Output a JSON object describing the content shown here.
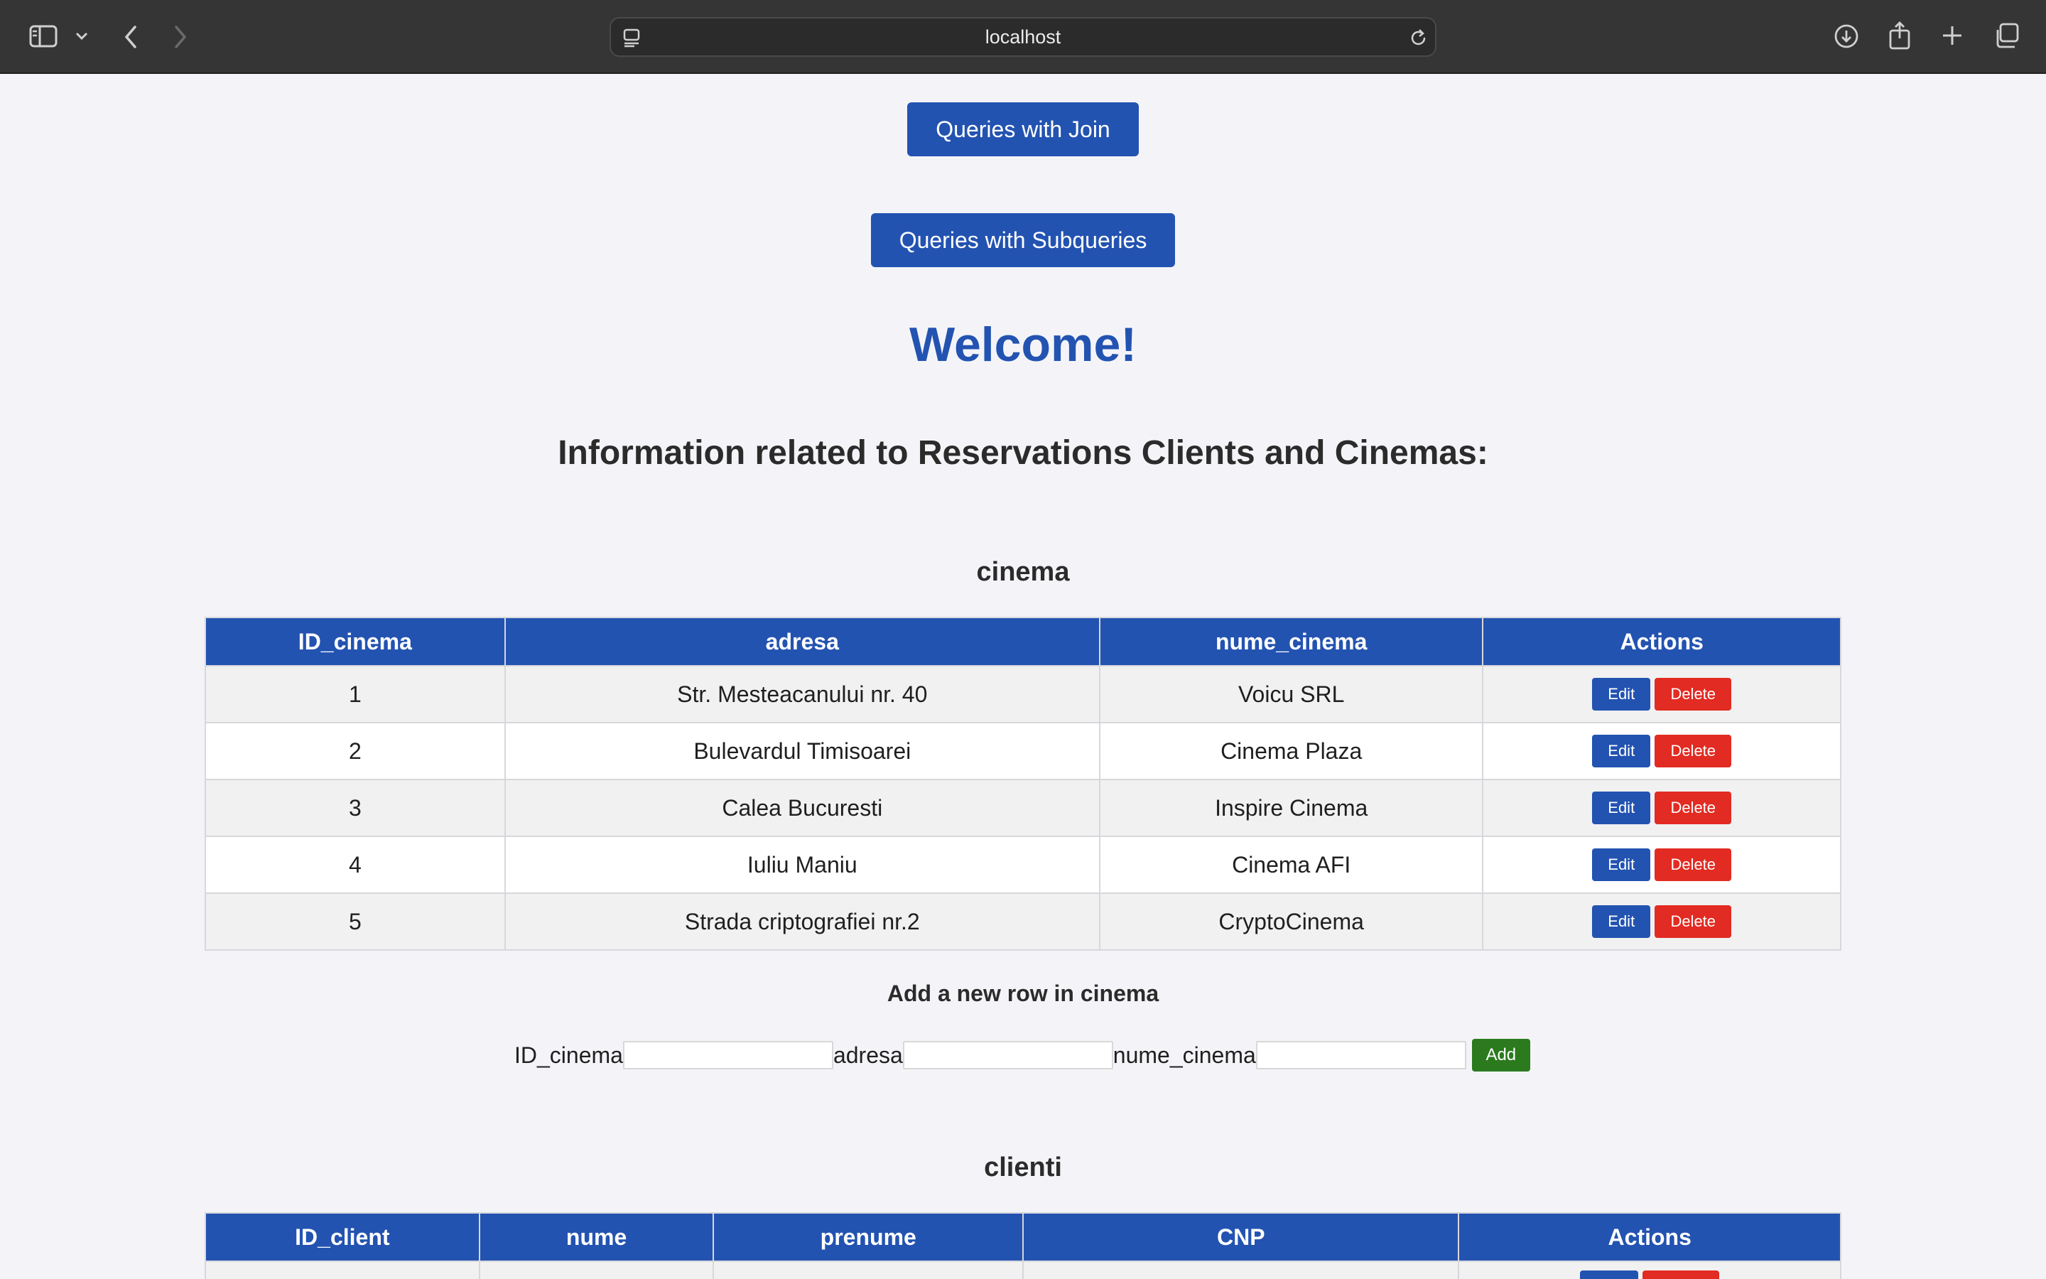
{
  "browser": {
    "url": "localhost",
    "icons": {
      "sidebar": "sidebar-icon",
      "chevron": "chevron-down-icon",
      "back": "back-arrow-icon",
      "forward": "forward-arrow-icon",
      "site": "site-info-icon",
      "reload": "reload-icon",
      "download": "download-icon",
      "share": "share-icon",
      "new_tab": "plus-icon",
      "tabs": "tab-overview-icon"
    }
  },
  "nav": {
    "join_label": "Queries with Join",
    "subqueries_label": "Queries with Subqueries"
  },
  "welcome": "Welcome!",
  "subtitle": "Information related to Reservations Clients and Cinemas:",
  "cinema": {
    "title": "cinema",
    "columns": [
      "ID_cinema",
      "adresa",
      "nume_cinema",
      "Actions"
    ],
    "rows": [
      [
        "1",
        "Str. Mesteacanului nr. 40",
        "Voicu SRL"
      ],
      [
        "2",
        "Bulevardul Timisoarei",
        "Cinema Plaza"
      ],
      [
        "3",
        "Calea Bucuresti",
        "Inspire Cinema"
      ],
      [
        "4",
        "Iuliu Maniu",
        "Cinema AFI"
      ],
      [
        "5",
        "Strada criptografiei nr.2",
        "CryptoCinema"
      ]
    ],
    "edit_label": "Edit",
    "delete_label": "Delete",
    "add_title": "Add a new row in cinema",
    "form_labels": [
      "ID_cinema",
      "adresa",
      "nume_cinema"
    ],
    "form_values": [
      "",
      "",
      ""
    ],
    "add_label": "Add"
  },
  "clienti": {
    "title": "clienti",
    "columns": [
      "ID_client",
      "nume",
      "prenume",
      "CNP",
      "Actions"
    ]
  },
  "colors": {
    "primary": "#2353b1",
    "danger": "#e22b22",
    "success": "#2b7a1e",
    "toolbar": "#353535"
  }
}
